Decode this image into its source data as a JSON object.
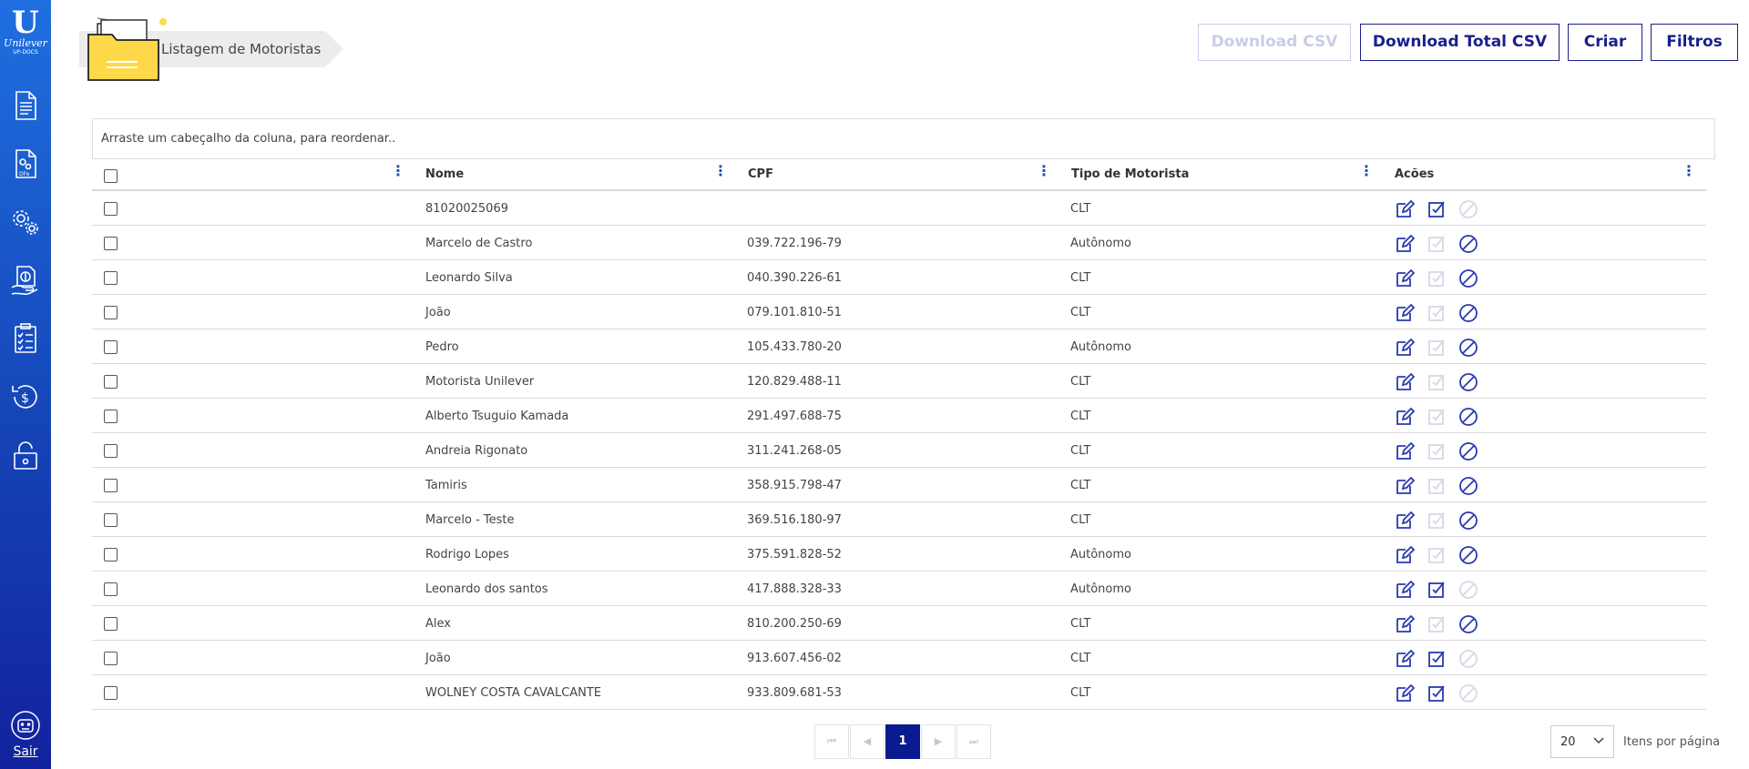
{
  "sidebar": {
    "logo_text": "Unilever",
    "logo_sub": "UP-DOCS",
    "items": [
      {
        "icon": "document-icon"
      },
      {
        "icon": "dfe-gear-document-icon"
      },
      {
        "icon": "settings-gears-icon"
      },
      {
        "icon": "money-hand-icon"
      },
      {
        "icon": "checklist-icon"
      },
      {
        "icon": "refund-dollar-icon"
      },
      {
        "icon": "lock-icon"
      }
    ],
    "logout_label": "Sair"
  },
  "header": {
    "title": "Listagem de Motoristas",
    "buttons": {
      "download_csv": "Download CSV",
      "download_total_csv": "Download Total CSV",
      "create": "Criar",
      "filters": "Filtros"
    }
  },
  "grid": {
    "group_hint": "Arraste um cabeçalho da coluna, para reordenar..",
    "columns": [
      "Nome",
      "CPF",
      "Tipo de Motorista",
      "Acões"
    ],
    "rows": [
      {
        "nome": "81020025069",
        "cpf": "",
        "tipo": "CLT",
        "approve_enabled": true,
        "block_enabled": false
      },
      {
        "nome": "Marcelo de Castro",
        "cpf": "039.722.196-79",
        "tipo": "Autônomo",
        "approve_enabled": false,
        "block_enabled": true
      },
      {
        "nome": "Leonardo Silva",
        "cpf": "040.390.226-61",
        "tipo": "CLT",
        "approve_enabled": false,
        "block_enabled": true
      },
      {
        "nome": "João",
        "cpf": "079.101.810-51",
        "tipo": "CLT",
        "approve_enabled": false,
        "block_enabled": true
      },
      {
        "nome": "Pedro",
        "cpf": "105.433.780-20",
        "tipo": "Autônomo",
        "approve_enabled": false,
        "block_enabled": true
      },
      {
        "nome": "Motorista Unilever",
        "cpf": "120.829.488-11",
        "tipo": "CLT",
        "approve_enabled": false,
        "block_enabled": true
      },
      {
        "nome": "Alberto Tsuguio Kamada",
        "cpf": "291.497.688-75",
        "tipo": "CLT",
        "approve_enabled": false,
        "block_enabled": true
      },
      {
        "nome": "Andreia Rigonato",
        "cpf": "311.241.268-05",
        "tipo": "CLT",
        "approve_enabled": false,
        "block_enabled": true
      },
      {
        "nome": "Tamiris",
        "cpf": "358.915.798-47",
        "tipo": "CLT",
        "approve_enabled": false,
        "block_enabled": true
      },
      {
        "nome": "Marcelo - Teste",
        "cpf": "369.516.180-97",
        "tipo": "CLT",
        "approve_enabled": false,
        "block_enabled": true
      },
      {
        "nome": "Rodrigo Lopes",
        "cpf": "375.591.828-52",
        "tipo": "Autônomo",
        "approve_enabled": false,
        "block_enabled": true
      },
      {
        "nome": "Leonardo dos santos",
        "cpf": "417.888.328-33",
        "tipo": "Autônomo",
        "approve_enabled": true,
        "block_enabled": false
      },
      {
        "nome": "Alex",
        "cpf": "810.200.250-69",
        "tipo": "CLT",
        "approve_enabled": false,
        "block_enabled": true
      },
      {
        "nome": "João",
        "cpf": "913.607.456-02",
        "tipo": "CLT",
        "approve_enabled": true,
        "block_enabled": false
      },
      {
        "nome": "WOLNEY COSTA CAVALCANTE",
        "cpf": "933.809.681-53",
        "tipo": "CLT",
        "approve_enabled": true,
        "block_enabled": false
      }
    ]
  },
  "pager": {
    "current_page": "1",
    "page_size": "20",
    "page_size_label": "Itens por página"
  },
  "colors": {
    "primary": "#1a1f8c",
    "sidebar_top": "#1f6fe0",
    "sidebar_bottom": "#12229e",
    "action_enabled": "#2a3ab0",
    "action_disabled": "#d5d8e6"
  }
}
